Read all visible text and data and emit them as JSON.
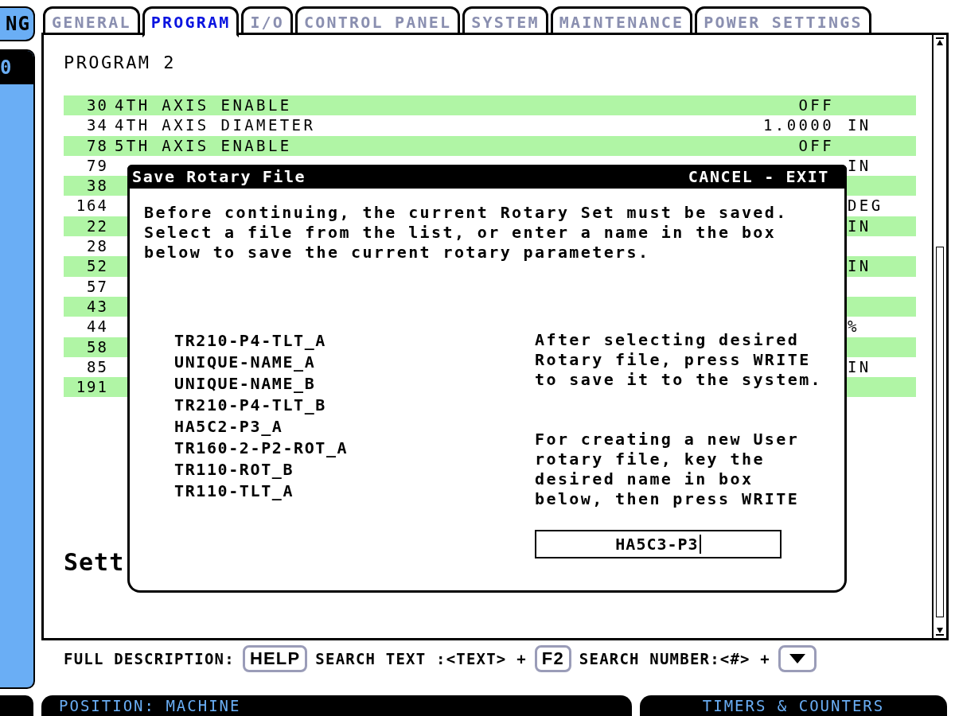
{
  "side_tab": {
    "label": "NG"
  },
  "side_panel": {
    "value": "0"
  },
  "tabs": [
    {
      "label": "GENERAL",
      "selected": false
    },
    {
      "label": "PROGRAM",
      "selected": true
    },
    {
      "label": "I/O",
      "selected": false
    },
    {
      "label": "CONTROL PANEL",
      "selected": false
    },
    {
      "label": "SYSTEM",
      "selected": false
    },
    {
      "label": "MAINTENANCE",
      "selected": false
    },
    {
      "label": "POWER SETTINGS",
      "selected": false
    }
  ],
  "panel": {
    "title": "PROGRAM 2",
    "rows": [
      {
        "number": "30",
        "name": "4TH AXIS ENABLE",
        "value": "OFF"
      },
      {
        "number": "34",
        "name": "4TH AXIS DIAMETER",
        "value": "1.0000",
        "unit": "IN"
      },
      {
        "number": "78",
        "name": "5TH AXIS ENABLE",
        "value": "OFF"
      },
      {
        "number": "79",
        "unit": "IN"
      },
      {
        "number": "38"
      },
      {
        "number": "164",
        "unit": "DEG"
      },
      {
        "number": "22",
        "unit": "IN"
      },
      {
        "number": "28"
      },
      {
        "number": "52",
        "unit": "IN"
      },
      {
        "number": "57"
      },
      {
        "number": "43"
      },
      {
        "number": "44",
        "unit": "%"
      },
      {
        "number": "58"
      },
      {
        "number": "85",
        "unit": "IN"
      },
      {
        "number": "191"
      }
    ],
    "section_heading": "Sett"
  },
  "dialog": {
    "title": "Save Rotary File",
    "cancel": "CANCEL - EXIT",
    "message": "Before continuing, the current Rotary Set must be saved.\nSelect a file from the list, or enter a name in the box\nbelow to save the current rotary parameters.",
    "files": [
      "TR210-P4-TLT_A",
      "UNIQUE-NAME_A",
      "UNIQUE-NAME_B",
      "TR210-P4-TLT_B",
      "HA5C2-P3_A",
      "TR160-2-P2-ROT_A",
      "TR110-ROT_B",
      "TR110-TLT_A"
    ],
    "help_texts": [
      "After selecting desired\nRotary file, press WRITE\nto save it to the system.",
      "For creating a new User\nrotary file, key the\ndesired name in box\nbelow, then press WRITE"
    ],
    "file_name_field": {
      "value": "HA5C3-P3"
    }
  },
  "hint_bar": [
    {
      "kind": "text",
      "text": "FULL DESCRIPTION:"
    },
    {
      "kind": "key",
      "label": "HELP"
    },
    {
      "kind": "text",
      "text": "SEARCH TEXT :<TEXT> +"
    },
    {
      "kind": "key",
      "label": "F2"
    },
    {
      "kind": "text",
      "text": "SEARCH NUMBER:<#> +"
    },
    {
      "kind": "arrow-key"
    }
  ],
  "bottom_bars": [
    {
      "label": "POSITION: MACHINE"
    },
    {
      "label": "TIMERS & COUNTERS"
    }
  ]
}
